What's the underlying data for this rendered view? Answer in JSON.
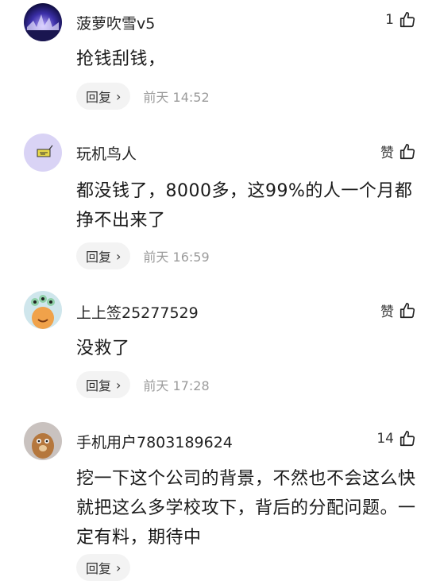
{
  "comments": [
    {
      "username": "菠萝吹雪v5",
      "likes": "1",
      "text": "抢钱刮钱，",
      "reply_label": "回复",
      "time": "前天 14:52"
    },
    {
      "username": "玩机鸟人",
      "likes": "赞",
      "text": "都没钱了，8000多，这99%的人一个月都挣不出来了",
      "reply_label": "回复",
      "time": "前天 16:59"
    },
    {
      "username": "上上签25277529",
      "likes": "赞",
      "text": "没救了",
      "reply_label": "回复",
      "time": "前天 17:28"
    },
    {
      "username": "手机用户7803189624",
      "likes": "14",
      "text": "挖一下这个公司的背景，不然也不会这么快就把这么多学校攻下，背后的分配问题。一定有料，期待中",
      "reply_label": "回复",
      "time": ""
    }
  ],
  "icons": {
    "like": "thumbs-up-outline",
    "reply_chevron": "chevron-right"
  },
  "colors": {
    "meta_gray": "#9b9b9b",
    "reply_bg": "#f3f3f3",
    "avatar1": "#2a2c8a",
    "avatar2": "#d9d3f5",
    "avatar3": "#cfe6ec",
    "avatar4": "#c9c2bf"
  }
}
